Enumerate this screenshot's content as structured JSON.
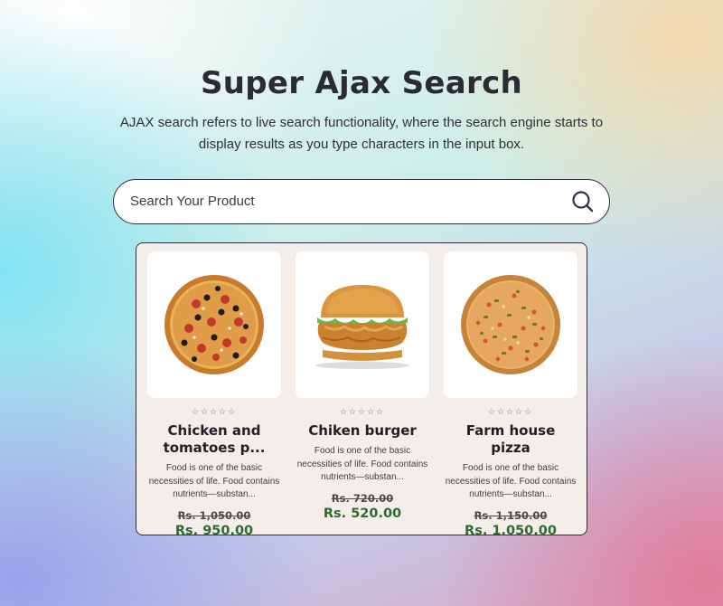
{
  "header": {
    "title": "Super Ajax Search",
    "subtitle": "AJAX search refers to live search functionality, where the search engine starts to display results as you type characters in the input box."
  },
  "search": {
    "placeholder": "Search Your Product",
    "value": "",
    "icon": "search-icon"
  },
  "products": [
    {
      "name": "Chicken and tomatoes p...",
      "image": "pizza-olives-image",
      "rating": "☆☆☆☆☆",
      "description": "Food is one of the basic necessities of life. Food contains nutrients—substan...",
      "old_price": "Rs. 1,050.00",
      "price": "Rs. 950.00"
    },
    {
      "name": "Chiken burger",
      "image": "chicken-burger-image",
      "rating": "☆☆☆☆☆",
      "description": "Food is one of the basic necessities of life. Food contains nutrients—substan...",
      "old_price": "Rs. 720.00",
      "price": "Rs. 520.00"
    },
    {
      "name": "Farm house pizza",
      "image": "farmhouse-pizza-image",
      "rating": "☆☆☆☆☆",
      "description": "Food is one of the basic necessities of life. Food contains nutrients—substan...",
      "old_price": "Rs. 1,150.00",
      "price": "Rs. 1,050.00"
    }
  ],
  "colors": {
    "price_green": "#2f6b2f",
    "panel_bg": "#f3eee9",
    "border": "#2f2f3c"
  }
}
